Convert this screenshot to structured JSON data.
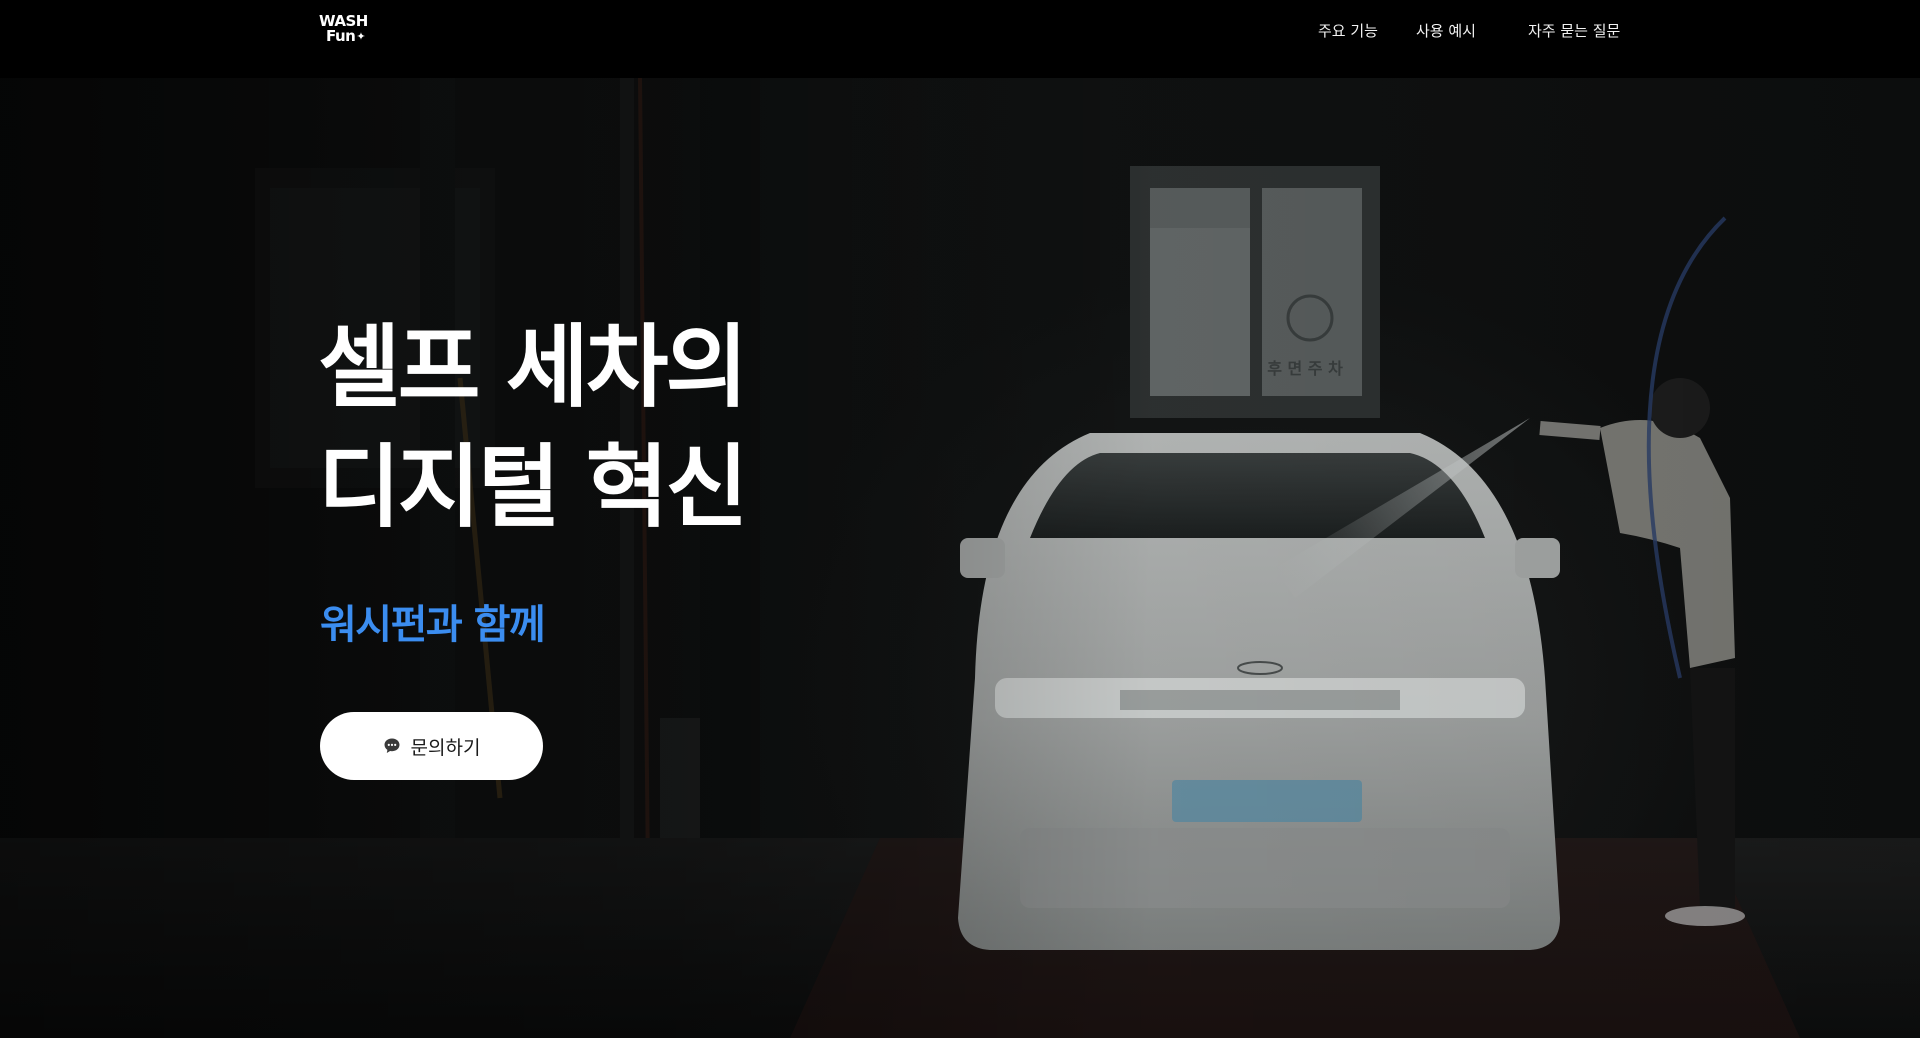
{
  "brand": {
    "logo_line1": "WASH",
    "logo_line2": "Fun",
    "logo_mark": "✦"
  },
  "nav": {
    "items": [
      {
        "label": "주요 기능"
      },
      {
        "label": "사용 예시"
      },
      {
        "label": "자주 묻는 질문"
      }
    ]
  },
  "hero": {
    "title_line1": "셀프 세차의",
    "title_line2": "디지털 혁신",
    "subtitle": "워시펀과 함께",
    "cta_label": "문의하기",
    "cta_icon": "chat-bubble-icon"
  },
  "scene": {
    "window_sign": "후 면 주 차"
  },
  "colors": {
    "accent": "#3b8df0",
    "background": "#000000",
    "cta_background": "#ffffff"
  }
}
